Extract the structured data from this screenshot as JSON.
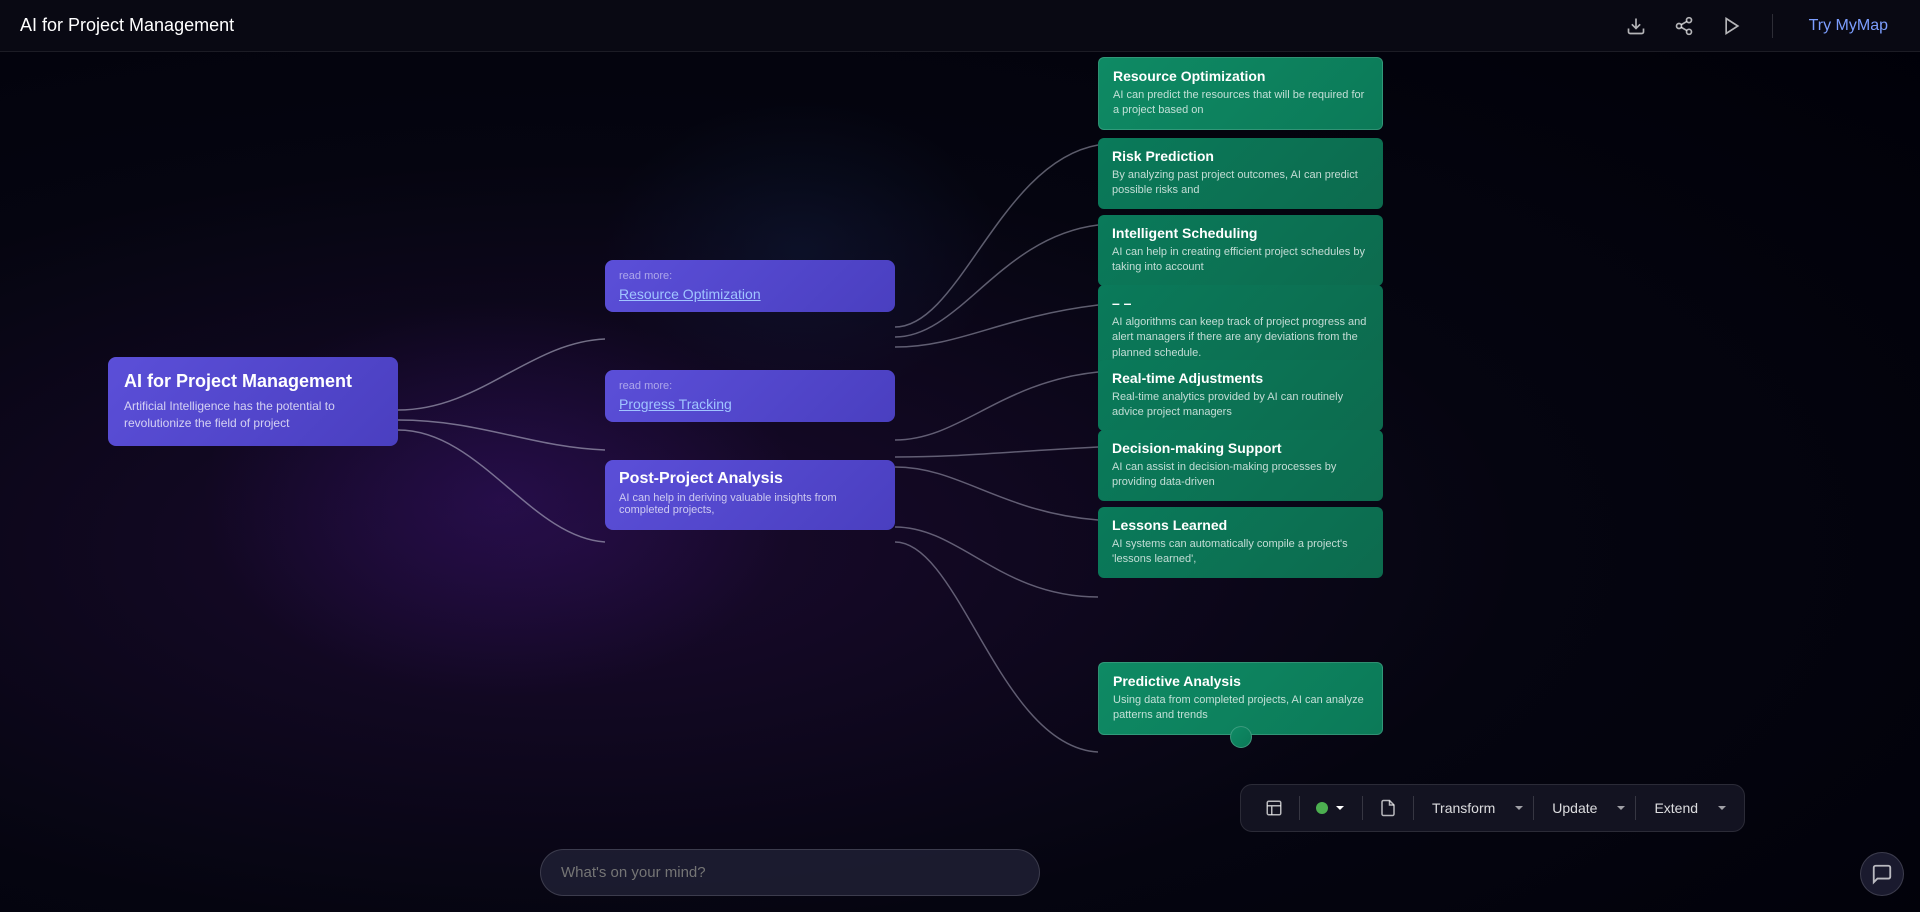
{
  "app": {
    "title": "AI for Project Management",
    "try_btn": "Try MyMap"
  },
  "header": {
    "download_icon": "⬇",
    "share_icon": "⇗",
    "play_icon": "▶"
  },
  "central_node": {
    "title": "AI for Project Management",
    "description": "Artificial Intelligence has the potential to revolutionize the field of project"
  },
  "branch_nodes": [
    {
      "id": "branch1",
      "read_more": "read more:",
      "link": "Resource Optimization"
    },
    {
      "id": "branch2",
      "read_more": "read more:",
      "link": "Progress Tracking"
    },
    {
      "id": "branch3",
      "title": "Post-Project Analysis",
      "description": "AI can help in deriving valuable insights from completed projects,"
    }
  ],
  "leaf_nodes": [
    {
      "id": "leaf1",
      "title": "Resource Optimization",
      "description": "AI can predict the resources that will be required for a project based on"
    },
    {
      "id": "leaf2",
      "title": "Risk Prediction",
      "description": "By analyzing past project outcomes, AI can predict possible risks and"
    },
    {
      "id": "leaf3",
      "title": "Intelligent Scheduling",
      "description": "AI can help in creating efficient project schedules by taking into account"
    },
    {
      "id": "leaf4",
      "title": "– –",
      "description": "AI algorithms can keep track of project progress and alert managers if there are any deviations from the planned schedule."
    },
    {
      "id": "leaf5",
      "title": "Real-time Adjustments",
      "description": "Real-time analytics provided by AI can routinely advice project managers"
    },
    {
      "id": "leaf6",
      "title": "Decision-making Support",
      "description": "AI can assist in decision-making processes by providing data-driven"
    },
    {
      "id": "leaf7",
      "title": "Lessons Learned",
      "description": "AI systems can automatically compile a project's 'lessons learned',"
    },
    {
      "id": "leaf8",
      "title": "Predictive Analysis",
      "description": "Using data from completed projects, AI can analyze patterns and trends"
    }
  ],
  "toolbar": {
    "transform_label": "Transform",
    "update_label": "Update",
    "extend_label": "Extend"
  },
  "chat_input": {
    "placeholder": "What's on your mind?"
  }
}
